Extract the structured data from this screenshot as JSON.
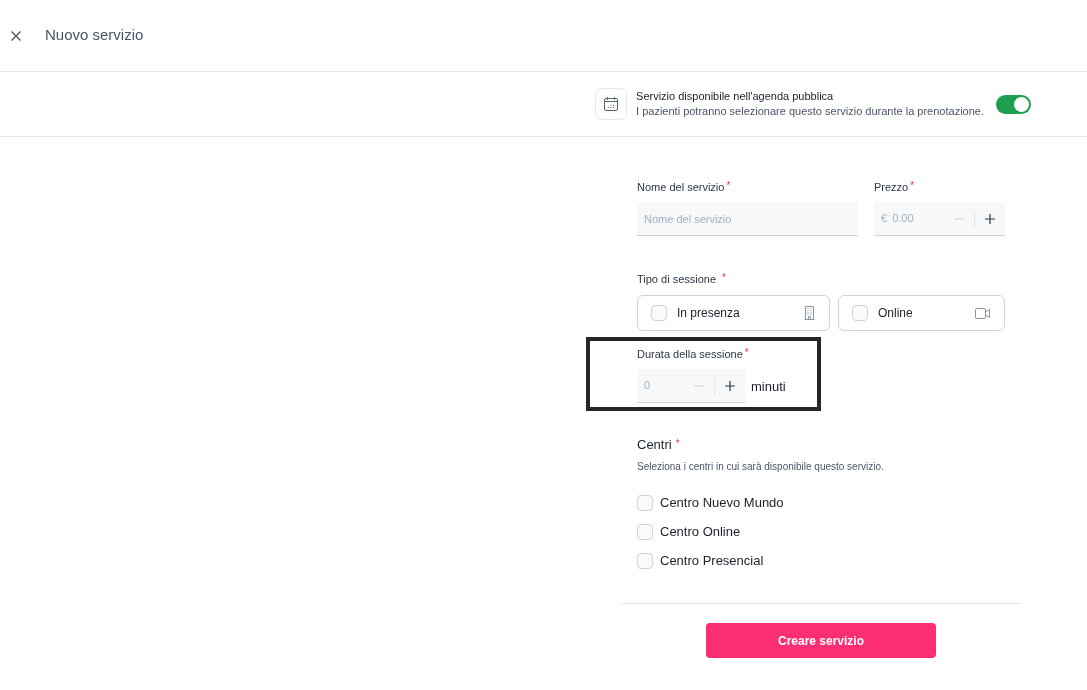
{
  "header": {
    "title": "Nuovo servizio"
  },
  "public_agenda": {
    "title": "Servizio disponibile nell'agenda pubblica",
    "description": "I pazienti potranno selezionare questo servizio durante la prenotazione.",
    "on": true
  },
  "service_name": {
    "label": "Nome del servizio",
    "required_mark": "*",
    "placeholder": "Nome del servizio"
  },
  "price": {
    "label": "Prezzo",
    "required_mark": "*",
    "currency": "€",
    "placeholder": "0.00",
    "decrement_disabled": true
  },
  "session_type": {
    "label": "Tipo di sessione",
    "required_mark": "*",
    "options": [
      {
        "label": "In presenza",
        "kind": "in_person",
        "checked": false
      },
      {
        "label": "Online",
        "kind": "online",
        "checked": false
      }
    ]
  },
  "duration": {
    "label": "Durata della sessione",
    "required_mark": "*",
    "placeholder": "0",
    "decrement_disabled": true,
    "unit": "minuti",
    "highlighted": true
  },
  "centers": {
    "title": "Centri",
    "required_mark": "*",
    "description": "Seleziona i centri in cui sarà disponibile questo servizio.",
    "options": [
      {
        "label": "Centro Nuevo Mundo",
        "checked": false
      },
      {
        "label": "Centro Online",
        "checked": false
      },
      {
        "label": "Centro Presencial",
        "checked": false
      }
    ]
  },
  "submit": {
    "label": "Creare servizio"
  }
}
